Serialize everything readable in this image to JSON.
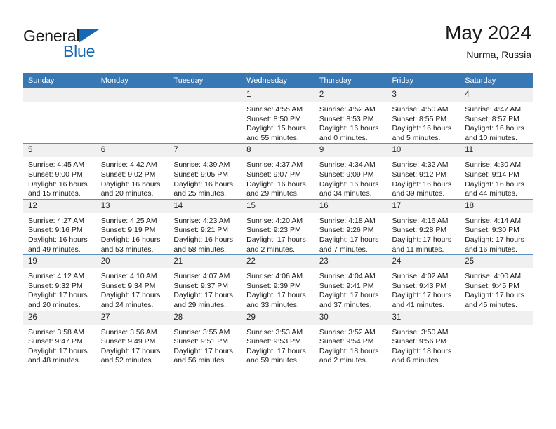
{
  "brand": {
    "name_part1": "General",
    "name_part2": "Blue",
    "triangle_color": "#1668b3"
  },
  "header": {
    "title": "May 2024",
    "subtitle": "Nurma, Russia"
  },
  "calendar": {
    "weekday_headers": [
      "Sunday",
      "Monday",
      "Tuesday",
      "Wednesday",
      "Thursday",
      "Friday",
      "Saturday"
    ],
    "header_bg": "#3878b4",
    "daynum_bg": "#f0f0f0",
    "weeks": [
      [
        {
          "day": "",
          "lines": []
        },
        {
          "day": "",
          "lines": []
        },
        {
          "day": "",
          "lines": []
        },
        {
          "day": "1",
          "lines": [
            "Sunrise: 4:55 AM",
            "Sunset: 8:50 PM",
            "Daylight: 15 hours",
            "and 55 minutes."
          ]
        },
        {
          "day": "2",
          "lines": [
            "Sunrise: 4:52 AM",
            "Sunset: 8:53 PM",
            "Daylight: 16 hours",
            "and 0 minutes."
          ]
        },
        {
          "day": "3",
          "lines": [
            "Sunrise: 4:50 AM",
            "Sunset: 8:55 PM",
            "Daylight: 16 hours",
            "and 5 minutes."
          ]
        },
        {
          "day": "4",
          "lines": [
            "Sunrise: 4:47 AM",
            "Sunset: 8:57 PM",
            "Daylight: 16 hours",
            "and 10 minutes."
          ]
        }
      ],
      [
        {
          "day": "5",
          "lines": [
            "Sunrise: 4:45 AM",
            "Sunset: 9:00 PM",
            "Daylight: 16 hours",
            "and 15 minutes."
          ]
        },
        {
          "day": "6",
          "lines": [
            "Sunrise: 4:42 AM",
            "Sunset: 9:02 PM",
            "Daylight: 16 hours",
            "and 20 minutes."
          ]
        },
        {
          "day": "7",
          "lines": [
            "Sunrise: 4:39 AM",
            "Sunset: 9:05 PM",
            "Daylight: 16 hours",
            "and 25 minutes."
          ]
        },
        {
          "day": "8",
          "lines": [
            "Sunrise: 4:37 AM",
            "Sunset: 9:07 PM",
            "Daylight: 16 hours",
            "and 29 minutes."
          ]
        },
        {
          "day": "9",
          "lines": [
            "Sunrise: 4:34 AM",
            "Sunset: 9:09 PM",
            "Daylight: 16 hours",
            "and 34 minutes."
          ]
        },
        {
          "day": "10",
          "lines": [
            "Sunrise: 4:32 AM",
            "Sunset: 9:12 PM",
            "Daylight: 16 hours",
            "and 39 minutes."
          ]
        },
        {
          "day": "11",
          "lines": [
            "Sunrise: 4:30 AM",
            "Sunset: 9:14 PM",
            "Daylight: 16 hours",
            "and 44 minutes."
          ]
        }
      ],
      [
        {
          "day": "12",
          "lines": [
            "Sunrise: 4:27 AM",
            "Sunset: 9:16 PM",
            "Daylight: 16 hours",
            "and 49 minutes."
          ]
        },
        {
          "day": "13",
          "lines": [
            "Sunrise: 4:25 AM",
            "Sunset: 9:19 PM",
            "Daylight: 16 hours",
            "and 53 minutes."
          ]
        },
        {
          "day": "14",
          "lines": [
            "Sunrise: 4:23 AM",
            "Sunset: 9:21 PM",
            "Daylight: 16 hours",
            "and 58 minutes."
          ]
        },
        {
          "day": "15",
          "lines": [
            "Sunrise: 4:20 AM",
            "Sunset: 9:23 PM",
            "Daylight: 17 hours",
            "and 2 minutes."
          ]
        },
        {
          "day": "16",
          "lines": [
            "Sunrise: 4:18 AM",
            "Sunset: 9:26 PM",
            "Daylight: 17 hours",
            "and 7 minutes."
          ]
        },
        {
          "day": "17",
          "lines": [
            "Sunrise: 4:16 AM",
            "Sunset: 9:28 PM",
            "Daylight: 17 hours",
            "and 11 minutes."
          ]
        },
        {
          "day": "18",
          "lines": [
            "Sunrise: 4:14 AM",
            "Sunset: 9:30 PM",
            "Daylight: 17 hours",
            "and 16 minutes."
          ]
        }
      ],
      [
        {
          "day": "19",
          "lines": [
            "Sunrise: 4:12 AM",
            "Sunset: 9:32 PM",
            "Daylight: 17 hours",
            "and 20 minutes."
          ]
        },
        {
          "day": "20",
          "lines": [
            "Sunrise: 4:10 AM",
            "Sunset: 9:34 PM",
            "Daylight: 17 hours",
            "and 24 minutes."
          ]
        },
        {
          "day": "21",
          "lines": [
            "Sunrise: 4:07 AM",
            "Sunset: 9:37 PM",
            "Daylight: 17 hours",
            "and 29 minutes."
          ]
        },
        {
          "day": "22",
          "lines": [
            "Sunrise: 4:06 AM",
            "Sunset: 9:39 PM",
            "Daylight: 17 hours",
            "and 33 minutes."
          ]
        },
        {
          "day": "23",
          "lines": [
            "Sunrise: 4:04 AM",
            "Sunset: 9:41 PM",
            "Daylight: 17 hours",
            "and 37 minutes."
          ]
        },
        {
          "day": "24",
          "lines": [
            "Sunrise: 4:02 AM",
            "Sunset: 9:43 PM",
            "Daylight: 17 hours",
            "and 41 minutes."
          ]
        },
        {
          "day": "25",
          "lines": [
            "Sunrise: 4:00 AM",
            "Sunset: 9:45 PM",
            "Daylight: 17 hours",
            "and 45 minutes."
          ]
        }
      ],
      [
        {
          "day": "26",
          "lines": [
            "Sunrise: 3:58 AM",
            "Sunset: 9:47 PM",
            "Daylight: 17 hours",
            "and 48 minutes."
          ]
        },
        {
          "day": "27",
          "lines": [
            "Sunrise: 3:56 AM",
            "Sunset: 9:49 PM",
            "Daylight: 17 hours",
            "and 52 minutes."
          ]
        },
        {
          "day": "28",
          "lines": [
            "Sunrise: 3:55 AM",
            "Sunset: 9:51 PM",
            "Daylight: 17 hours",
            "and 56 minutes."
          ]
        },
        {
          "day": "29",
          "lines": [
            "Sunrise: 3:53 AM",
            "Sunset: 9:53 PM",
            "Daylight: 17 hours",
            "and 59 minutes."
          ]
        },
        {
          "day": "30",
          "lines": [
            "Sunrise: 3:52 AM",
            "Sunset: 9:54 PM",
            "Daylight: 18 hours",
            "and 2 minutes."
          ]
        },
        {
          "day": "31",
          "lines": [
            "Sunrise: 3:50 AM",
            "Sunset: 9:56 PM",
            "Daylight: 18 hours",
            "and 6 minutes."
          ]
        },
        {
          "day": "",
          "lines": []
        }
      ]
    ]
  }
}
